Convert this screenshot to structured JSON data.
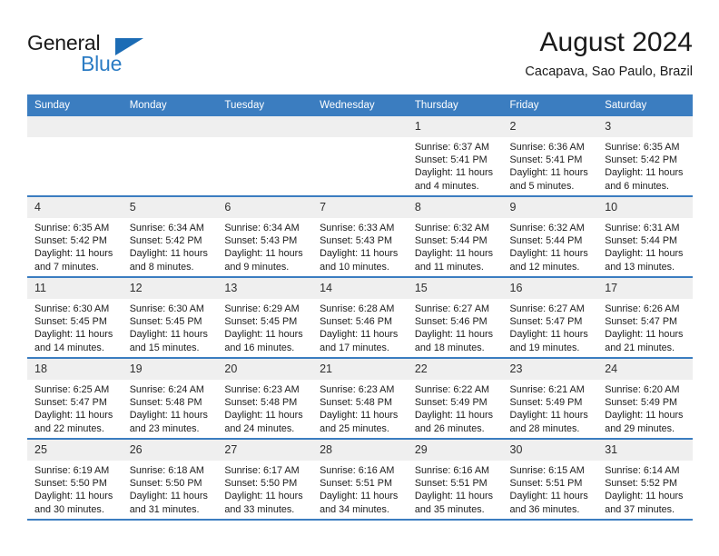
{
  "brand": {
    "name_top": "General",
    "name_bottom": "Blue",
    "accent_color": "#2b7cc4",
    "triangle_color": "#1c6cb5"
  },
  "header": {
    "title": "August 2024",
    "subtitle": "Cacapava, Sao Paulo, Brazil"
  },
  "calendar": {
    "header_bg": "#3b7dc0",
    "daynum_bg": "#efefef",
    "weekdays": [
      "Sunday",
      "Monday",
      "Tuesday",
      "Wednesday",
      "Thursday",
      "Friday",
      "Saturday"
    ],
    "weeks": [
      [
        {
          "day": "",
          "sunrise": "",
          "sunset": "",
          "daylight_line1": "",
          "daylight_line2": ""
        },
        {
          "day": "",
          "sunrise": "",
          "sunset": "",
          "daylight_line1": "",
          "daylight_line2": ""
        },
        {
          "day": "",
          "sunrise": "",
          "sunset": "",
          "daylight_line1": "",
          "daylight_line2": ""
        },
        {
          "day": "",
          "sunrise": "",
          "sunset": "",
          "daylight_line1": "",
          "daylight_line2": ""
        },
        {
          "day": "1",
          "sunrise": "Sunrise: 6:37 AM",
          "sunset": "Sunset: 5:41 PM",
          "daylight_line1": "Daylight: 11 hours",
          "daylight_line2": "and 4 minutes."
        },
        {
          "day": "2",
          "sunrise": "Sunrise: 6:36 AM",
          "sunset": "Sunset: 5:41 PM",
          "daylight_line1": "Daylight: 11 hours",
          "daylight_line2": "and 5 minutes."
        },
        {
          "day": "3",
          "sunrise": "Sunrise: 6:35 AM",
          "sunset": "Sunset: 5:42 PM",
          "daylight_line1": "Daylight: 11 hours",
          "daylight_line2": "and 6 minutes."
        }
      ],
      [
        {
          "day": "4",
          "sunrise": "Sunrise: 6:35 AM",
          "sunset": "Sunset: 5:42 PM",
          "daylight_line1": "Daylight: 11 hours",
          "daylight_line2": "and 7 minutes."
        },
        {
          "day": "5",
          "sunrise": "Sunrise: 6:34 AM",
          "sunset": "Sunset: 5:42 PM",
          "daylight_line1": "Daylight: 11 hours",
          "daylight_line2": "and 8 minutes."
        },
        {
          "day": "6",
          "sunrise": "Sunrise: 6:34 AM",
          "sunset": "Sunset: 5:43 PM",
          "daylight_line1": "Daylight: 11 hours",
          "daylight_line2": "and 9 minutes."
        },
        {
          "day": "7",
          "sunrise": "Sunrise: 6:33 AM",
          "sunset": "Sunset: 5:43 PM",
          "daylight_line1": "Daylight: 11 hours",
          "daylight_line2": "and 10 minutes."
        },
        {
          "day": "8",
          "sunrise": "Sunrise: 6:32 AM",
          "sunset": "Sunset: 5:44 PM",
          "daylight_line1": "Daylight: 11 hours",
          "daylight_line2": "and 11 minutes."
        },
        {
          "day": "9",
          "sunrise": "Sunrise: 6:32 AM",
          "sunset": "Sunset: 5:44 PM",
          "daylight_line1": "Daylight: 11 hours",
          "daylight_line2": "and 12 minutes."
        },
        {
          "day": "10",
          "sunrise": "Sunrise: 6:31 AM",
          "sunset": "Sunset: 5:44 PM",
          "daylight_line1": "Daylight: 11 hours",
          "daylight_line2": "and 13 minutes."
        }
      ],
      [
        {
          "day": "11",
          "sunrise": "Sunrise: 6:30 AM",
          "sunset": "Sunset: 5:45 PM",
          "daylight_line1": "Daylight: 11 hours",
          "daylight_line2": "and 14 minutes."
        },
        {
          "day": "12",
          "sunrise": "Sunrise: 6:30 AM",
          "sunset": "Sunset: 5:45 PM",
          "daylight_line1": "Daylight: 11 hours",
          "daylight_line2": "and 15 minutes."
        },
        {
          "day": "13",
          "sunrise": "Sunrise: 6:29 AM",
          "sunset": "Sunset: 5:45 PM",
          "daylight_line1": "Daylight: 11 hours",
          "daylight_line2": "and 16 minutes."
        },
        {
          "day": "14",
          "sunrise": "Sunrise: 6:28 AM",
          "sunset": "Sunset: 5:46 PM",
          "daylight_line1": "Daylight: 11 hours",
          "daylight_line2": "and 17 minutes."
        },
        {
          "day": "15",
          "sunrise": "Sunrise: 6:27 AM",
          "sunset": "Sunset: 5:46 PM",
          "daylight_line1": "Daylight: 11 hours",
          "daylight_line2": "and 18 minutes."
        },
        {
          "day": "16",
          "sunrise": "Sunrise: 6:27 AM",
          "sunset": "Sunset: 5:47 PM",
          "daylight_line1": "Daylight: 11 hours",
          "daylight_line2": "and 19 minutes."
        },
        {
          "day": "17",
          "sunrise": "Sunrise: 6:26 AM",
          "sunset": "Sunset: 5:47 PM",
          "daylight_line1": "Daylight: 11 hours",
          "daylight_line2": "and 21 minutes."
        }
      ],
      [
        {
          "day": "18",
          "sunrise": "Sunrise: 6:25 AM",
          "sunset": "Sunset: 5:47 PM",
          "daylight_line1": "Daylight: 11 hours",
          "daylight_line2": "and 22 minutes."
        },
        {
          "day": "19",
          "sunrise": "Sunrise: 6:24 AM",
          "sunset": "Sunset: 5:48 PM",
          "daylight_line1": "Daylight: 11 hours",
          "daylight_line2": "and 23 minutes."
        },
        {
          "day": "20",
          "sunrise": "Sunrise: 6:23 AM",
          "sunset": "Sunset: 5:48 PM",
          "daylight_line1": "Daylight: 11 hours",
          "daylight_line2": "and 24 minutes."
        },
        {
          "day": "21",
          "sunrise": "Sunrise: 6:23 AM",
          "sunset": "Sunset: 5:48 PM",
          "daylight_line1": "Daylight: 11 hours",
          "daylight_line2": "and 25 minutes."
        },
        {
          "day": "22",
          "sunrise": "Sunrise: 6:22 AM",
          "sunset": "Sunset: 5:49 PM",
          "daylight_line1": "Daylight: 11 hours",
          "daylight_line2": "and 26 minutes."
        },
        {
          "day": "23",
          "sunrise": "Sunrise: 6:21 AM",
          "sunset": "Sunset: 5:49 PM",
          "daylight_line1": "Daylight: 11 hours",
          "daylight_line2": "and 28 minutes."
        },
        {
          "day": "24",
          "sunrise": "Sunrise: 6:20 AM",
          "sunset": "Sunset: 5:49 PM",
          "daylight_line1": "Daylight: 11 hours",
          "daylight_line2": "and 29 minutes."
        }
      ],
      [
        {
          "day": "25",
          "sunrise": "Sunrise: 6:19 AM",
          "sunset": "Sunset: 5:50 PM",
          "daylight_line1": "Daylight: 11 hours",
          "daylight_line2": "and 30 minutes."
        },
        {
          "day": "26",
          "sunrise": "Sunrise: 6:18 AM",
          "sunset": "Sunset: 5:50 PM",
          "daylight_line1": "Daylight: 11 hours",
          "daylight_line2": "and 31 minutes."
        },
        {
          "day": "27",
          "sunrise": "Sunrise: 6:17 AM",
          "sunset": "Sunset: 5:50 PM",
          "daylight_line1": "Daylight: 11 hours",
          "daylight_line2": "and 33 minutes."
        },
        {
          "day": "28",
          "sunrise": "Sunrise: 6:16 AM",
          "sunset": "Sunset: 5:51 PM",
          "daylight_line1": "Daylight: 11 hours",
          "daylight_line2": "and 34 minutes."
        },
        {
          "day": "29",
          "sunrise": "Sunrise: 6:16 AM",
          "sunset": "Sunset: 5:51 PM",
          "daylight_line1": "Daylight: 11 hours",
          "daylight_line2": "and 35 minutes."
        },
        {
          "day": "30",
          "sunrise": "Sunrise: 6:15 AM",
          "sunset": "Sunset: 5:51 PM",
          "daylight_line1": "Daylight: 11 hours",
          "daylight_line2": "and 36 minutes."
        },
        {
          "day": "31",
          "sunrise": "Sunrise: 6:14 AM",
          "sunset": "Sunset: 5:52 PM",
          "daylight_line1": "Daylight: 11 hours",
          "daylight_line2": "and 37 minutes."
        }
      ]
    ]
  }
}
